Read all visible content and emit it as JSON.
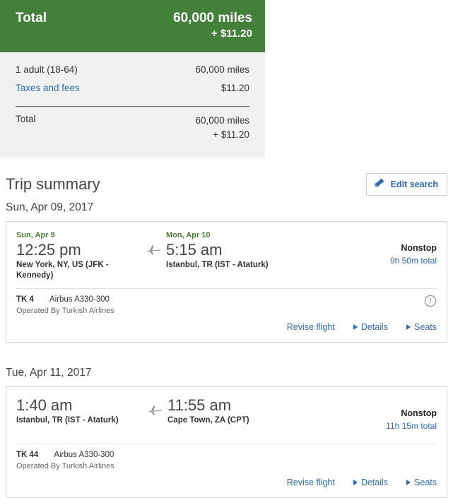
{
  "price_panel": {
    "header": {
      "label": "Total",
      "miles": "60,000 miles",
      "fees": "+ $11.20"
    },
    "rows": [
      {
        "label": "1 adult (18-64)",
        "value": "60,000 miles",
        "is_link": false
      },
      {
        "label": "Taxes and fees",
        "value": "$11.20",
        "is_link": true
      }
    ],
    "total": {
      "label": "Total",
      "miles": "60,000 miles",
      "fees": "+ $11.20"
    }
  },
  "trip_summary": {
    "title": "Trip summary",
    "edit_search_label": "Edit search",
    "edit_search_icon": "pencil-icon",
    "sections": [
      {
        "date_heading": "Sun, Apr 09, 2017",
        "card": {
          "departure": {
            "date": "Sun, Apr 9",
            "time": "12:25 pm",
            "place": "New York, NY, US (JFK - Kennedy)"
          },
          "arrival": {
            "date": "Mon, Apr 10",
            "time": "5:15 am",
            "place": "Istanbul, TR (IST - Ataturk)"
          },
          "plane_icon": "airplane-icon",
          "stops": "Nonstop",
          "duration": "9h 50m total",
          "flight_number": "TK 4",
          "aircraft": "Airbus A330-300",
          "operated_by": "Operated By Turkish Airlines",
          "warning_icon": "warning-circle-icon",
          "has_warning": true,
          "actions": [
            {
              "label": "Revise flight",
              "has_caret": false
            },
            {
              "label": "Details",
              "has_caret": true
            },
            {
              "label": "Seats",
              "has_caret": true
            }
          ]
        }
      },
      {
        "date_heading": "Tue, Apr 11, 2017",
        "card": {
          "departure": {
            "date": "",
            "time": "1:40 am",
            "place": "Istanbul, TR (IST - Ataturk)"
          },
          "arrival": {
            "date": "",
            "time": "11:55 am",
            "place": "Cape Town, ZA (CPT)"
          },
          "plane_icon": "airplane-icon",
          "stops": "Nonstop",
          "duration": "11h 15m total",
          "flight_number": "TK 44",
          "aircraft": "Airbus A330-300",
          "operated_by": "Operated By Turkish Airlines",
          "warning_icon": "",
          "has_warning": false,
          "actions": [
            {
              "label": "Revise flight",
              "has_caret": false
            },
            {
              "label": "Details",
              "has_caret": true
            },
            {
              "label": "Seats",
              "has_caret": true
            }
          ]
        }
      }
    ]
  },
  "colors": {
    "brand_green": "#43803a",
    "link_blue": "#2e6bb0",
    "panel_gray": "#f1f1f1",
    "date_green": "#4c7a34",
    "icon_gray": "#8a9a90"
  }
}
